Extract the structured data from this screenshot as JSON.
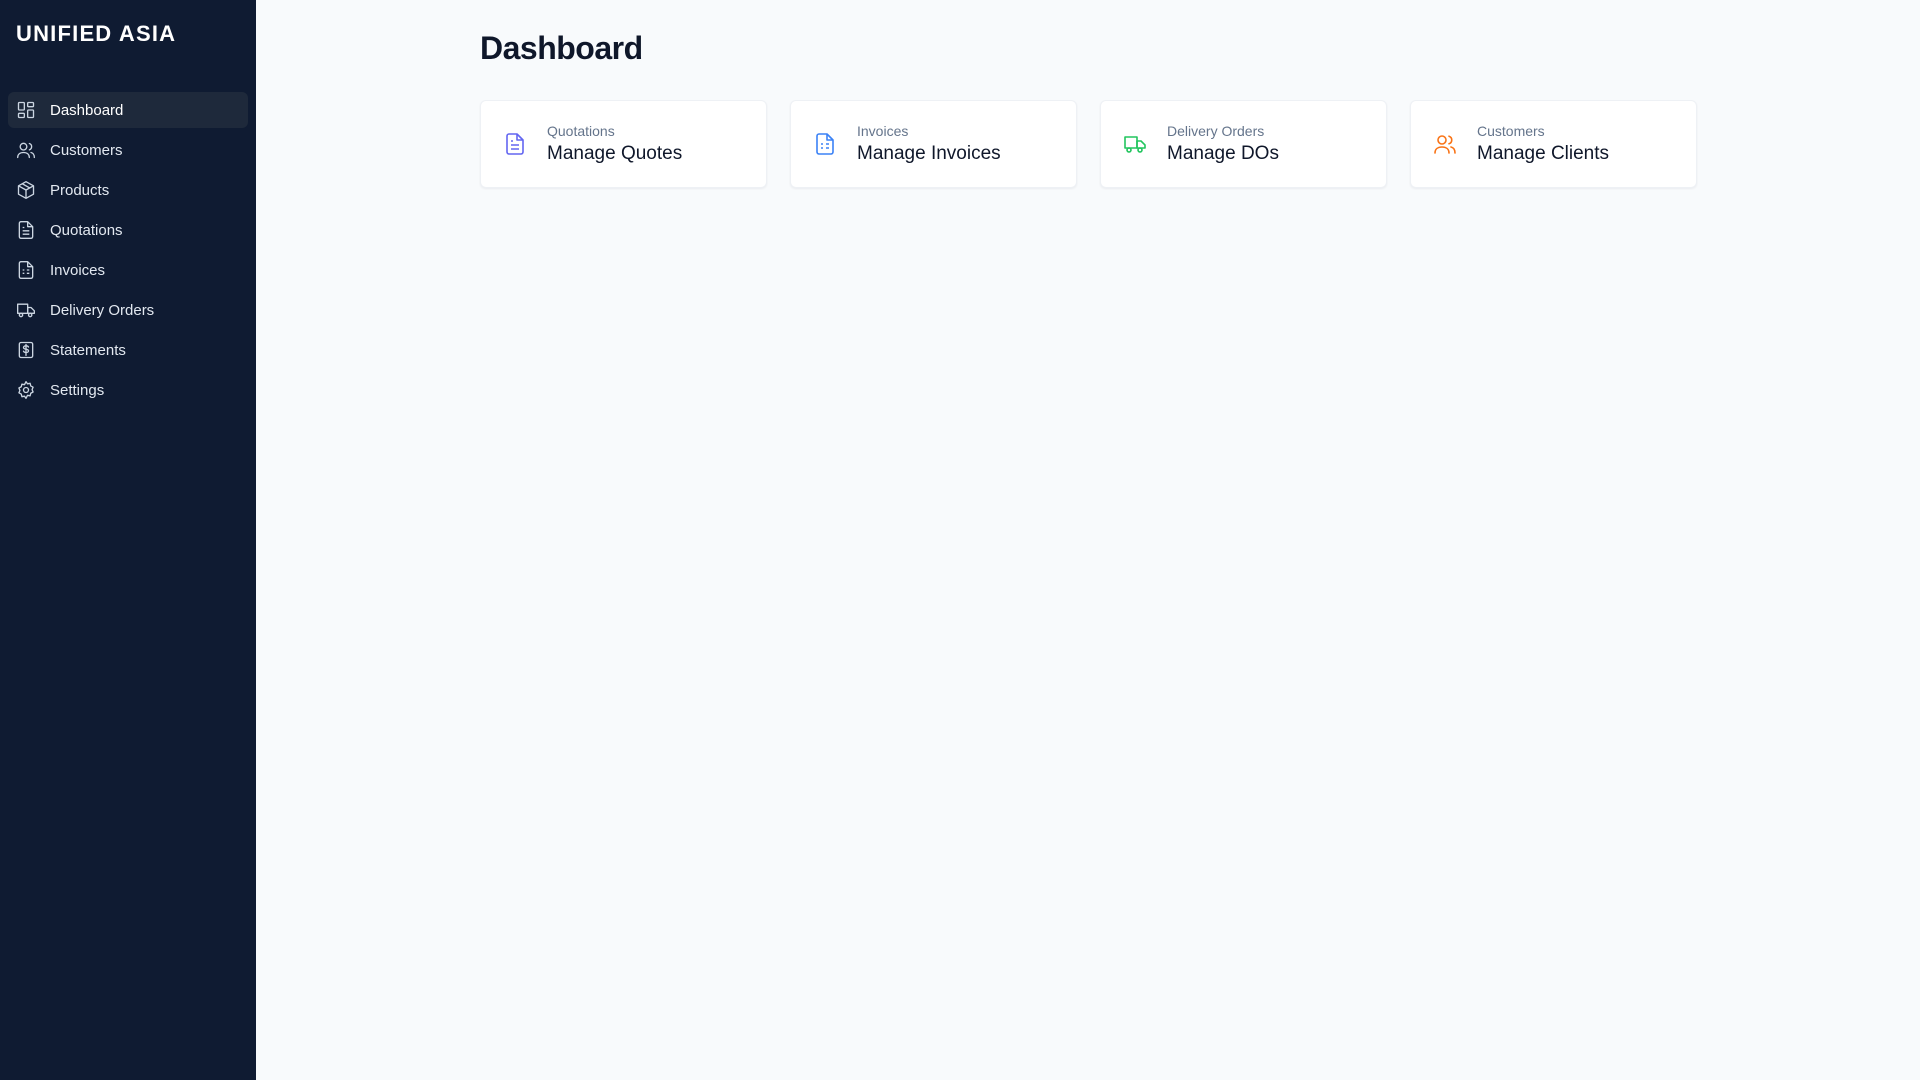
{
  "brand": "UNIFIED ASIA",
  "sidebar": {
    "items": [
      {
        "label": "Dashboard",
        "icon": "dashboard-icon",
        "active": true
      },
      {
        "label": "Customers",
        "icon": "users-icon",
        "active": false
      },
      {
        "label": "Products",
        "icon": "box-icon",
        "active": false
      },
      {
        "label": "Quotations",
        "icon": "document-icon",
        "active": false
      },
      {
        "label": "Invoices",
        "icon": "invoice-icon",
        "active": false
      },
      {
        "label": "Delivery Orders",
        "icon": "truck-icon",
        "active": false
      },
      {
        "label": "Statements",
        "icon": "dollar-statement-icon",
        "active": false
      },
      {
        "label": "Settings",
        "icon": "gear-icon",
        "active": false
      }
    ]
  },
  "main": {
    "title": "Dashboard",
    "cards": [
      {
        "sub": "Quotations",
        "title": "Manage Quotes",
        "icon": "document-icon",
        "color": "#6366f1"
      },
      {
        "sub": "Invoices",
        "title": "Manage Invoices",
        "icon": "invoice-icon",
        "color": "#3b82f6"
      },
      {
        "sub": "Delivery Orders",
        "title": "Manage DOs",
        "icon": "truck-icon",
        "color": "#22c55e"
      },
      {
        "sub": "Customers",
        "title": "Manage Clients",
        "icon": "users-icon",
        "color": "#f97316"
      }
    ]
  },
  "colors": {
    "sidebar_bg": "#0f1b32",
    "active_item_bg": "#1e293b",
    "page_bg": "#f8fafc"
  }
}
